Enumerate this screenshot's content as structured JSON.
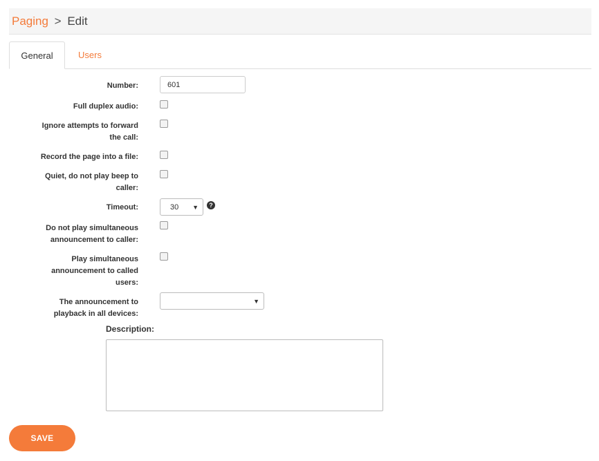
{
  "breadcrumb": {
    "parent": "Paging",
    "separator": ">",
    "current": "Edit"
  },
  "tabs": [
    {
      "label": "General",
      "active": true
    },
    {
      "label": "Users",
      "active": false
    }
  ],
  "form": {
    "number": {
      "label": "Number:",
      "value": "601"
    },
    "full_duplex": {
      "label": "Full duplex audio:",
      "checked": false
    },
    "ignore_forward": {
      "line1": "Ignore attempts to forward",
      "line2": "the call:",
      "checked": false
    },
    "record_page": {
      "label": "Record the page into a file:",
      "checked": false
    },
    "quiet": {
      "line1": "Quiet, do not play beep to",
      "line2": "caller:",
      "checked": false
    },
    "timeout": {
      "label": "Timeout:",
      "value": "30",
      "help": "?"
    },
    "no_simul_caller": {
      "line1": "Do not play simultaneous",
      "line2": "announcement to caller:",
      "checked": false
    },
    "play_simul_called": {
      "line1": "Play simultaneous",
      "line2": "announcement to called",
      "line3": "users:",
      "checked": false
    },
    "announcement": {
      "line1": "The announcement to",
      "line2": "playback in all devices:",
      "value": ""
    },
    "description": {
      "label": "Description:",
      "value": ""
    }
  },
  "actions": {
    "save_label": "SAVE"
  },
  "colors": {
    "accent": "#f47b3a"
  },
  "icons": {
    "dropdown": "caret-down-icon",
    "help": "question-circle-icon"
  }
}
